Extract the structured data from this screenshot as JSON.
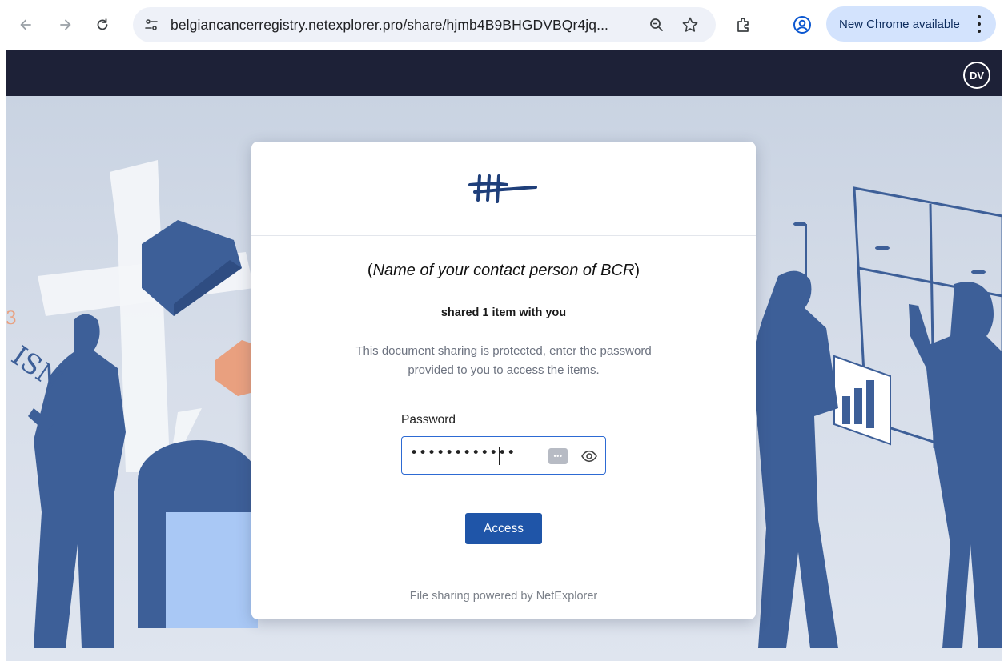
{
  "browser": {
    "url": "belgiancancerregistry.netexplorer.pro/share/hjmb4B9BHGDVBQr4jq...",
    "update_label": "New Chrome available",
    "icons": [
      "back-icon",
      "forward-icon",
      "reload-icon",
      "site-info-icon",
      "zoom-icon",
      "bookmark-star-icon",
      "extensions-icon",
      "profile-icon",
      "more-menu-icon"
    ]
  },
  "header": {
    "avatar_initials": "DV"
  },
  "dialog": {
    "sender_name": "Name of your contact person of BCR",
    "sender_open": "(",
    "sender_close": ")",
    "shared_text": "shared 1 item with you",
    "description": "This document sharing is protected, enter the password provided to you to access the items.",
    "password_label": "Password",
    "password_value": "••••••••••••",
    "access_label": "Access",
    "footer": "File sharing powered by NetExplorer"
  },
  "colors": {
    "header_bg": "#1d2137",
    "accent": "#1f55a8",
    "input_border": "#2d6ad3",
    "illustration_blue": "#3d5f98",
    "illustration_orange": "#e9a07f"
  }
}
